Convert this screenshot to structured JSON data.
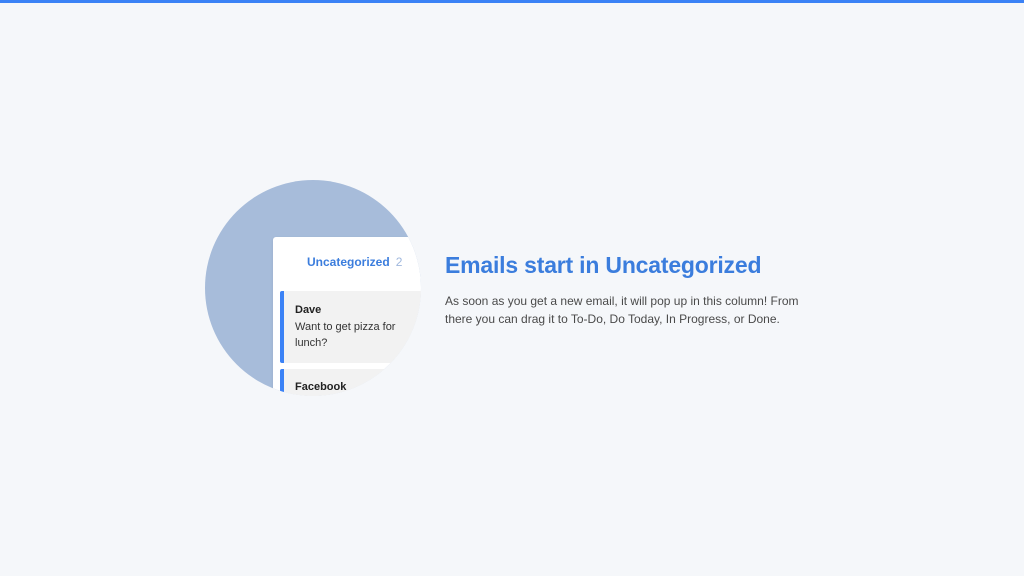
{
  "colors": {
    "accent": "#3b82f6",
    "heading": "#3b7ddd",
    "illustration_circle": "#a7bcda",
    "background": "#f5f7fa"
  },
  "illustration": {
    "column_title": "Uncategorized",
    "column_count": "2",
    "cards": [
      {
        "sender": "Dave",
        "preview": "Want to get pizza for lunch?"
      },
      {
        "sender": "Facebook",
        "preview": ""
      }
    ]
  },
  "content": {
    "heading": "Emails start in Uncategorized",
    "description": "As soon as you get a new email, it will pop up in this column! From there you can drag it to To-Do, Do Today, In Progress, or Done."
  }
}
